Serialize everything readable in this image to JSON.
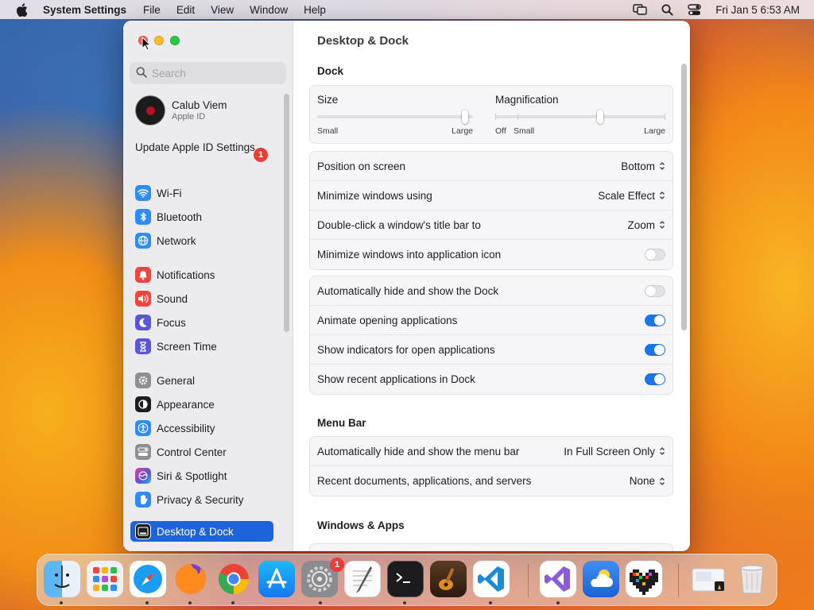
{
  "menubar": {
    "app_name": "System Settings",
    "menus": [
      "File",
      "Edit",
      "View",
      "Window",
      "Help"
    ],
    "clock": "Fri Jan 5  6:53 AM"
  },
  "sidebar": {
    "search_placeholder": "Search",
    "account_name": "Calub Viem",
    "account_sub": "Apple ID",
    "update_label": "Update Apple ID Settings",
    "update_badge": "1",
    "items": [
      {
        "label": "Wi-Fi",
        "icon": "wifi-icon",
        "color": "#2f8cf6"
      },
      {
        "label": "Bluetooth",
        "icon": "bluetooth-icon",
        "color": "#2f8cf6"
      },
      {
        "label": "Network",
        "icon": "globe-icon",
        "color": "#2f8cf6"
      },
      {
        "label": "Notifications",
        "icon": "bell-icon",
        "color": "#f0453a"
      },
      {
        "label": "Sound",
        "icon": "speaker-icon",
        "color": "#f0453a"
      },
      {
        "label": "Focus",
        "icon": "moon-icon",
        "color": "#5a56d6"
      },
      {
        "label": "Screen Time",
        "icon": "hourglass-icon",
        "color": "#5a56d6"
      },
      {
        "label": "General",
        "icon": "gear-icon",
        "color": "#8e8e93"
      },
      {
        "label": "Appearance",
        "icon": "appearance-icon",
        "color": "#1d1d1f"
      },
      {
        "label": "Accessibility",
        "icon": "accessibility-icon",
        "color": "#2f8cf6"
      },
      {
        "label": "Control Center",
        "icon": "control-center-icon",
        "color": "#8e8e93"
      },
      {
        "label": "Siri & Spotlight",
        "icon": "siri-icon",
        "color": "#b34fd6"
      },
      {
        "label": "Privacy & Security",
        "icon": "hand-icon",
        "color": "#2f8cf6"
      },
      {
        "label": "Desktop & Dock",
        "icon": "dock-icon",
        "color": "#1d1d1f"
      }
    ]
  },
  "main": {
    "title": "Desktop & Dock",
    "dock_section": "Dock",
    "size_label": "Size",
    "size_small": "Small",
    "size_large": "Large",
    "size_value": 0.97,
    "mag_label": "Magnification",
    "mag_off": "Off",
    "mag_small": "Small",
    "mag_large": "Large",
    "mag_value": 0.62,
    "rows_a": [
      {
        "label": "Position on screen",
        "value": "Bottom"
      },
      {
        "label": "Minimize windows using",
        "value": "Scale Effect"
      },
      {
        "label": "Double-click a window's title bar to",
        "value": "Zoom"
      }
    ],
    "minimize_into_icon": {
      "label": "Minimize windows into application icon",
      "on": false
    },
    "toggles": [
      {
        "label": "Automatically hide and show the Dock",
        "on": false
      },
      {
        "label": "Animate opening applications",
        "on": true
      },
      {
        "label": "Show indicators for open applications",
        "on": true
      },
      {
        "label": "Show recent applications in Dock",
        "on": true
      }
    ],
    "menubar_section": "Menu Bar",
    "menubar_rows": [
      {
        "label": "Automatically hide and show the menu bar",
        "value": "In Full Screen Only"
      },
      {
        "label": "Recent documents, applications, and servers",
        "value": "None"
      }
    ],
    "windows_section": "Windows & Apps"
  },
  "dock": {
    "apps": [
      "finder-icon",
      "launchpad-icon",
      "safari-icon",
      "firefox-icon",
      "chrome-icon",
      "app-store-icon",
      "system-settings-icon",
      "textedit-icon",
      "terminal-icon",
      "garageband-icon",
      "vscode-icon",
      "visual-studio-icon",
      "weather-icon",
      "pixel-heart-icon",
      "downloads-icon",
      "trash-icon"
    ],
    "settings_badge": "1"
  }
}
